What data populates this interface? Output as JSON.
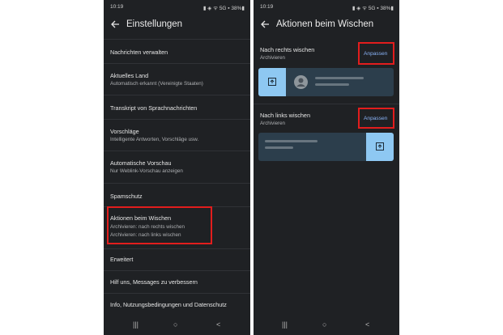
{
  "left_screen": {
    "status": {
      "time": "10:19",
      "right": "▮ ◈ ᯤ 5G ▪ 38%▮"
    },
    "title": "Einstellungen",
    "items": [
      {
        "title": "Nachrichten verwalten"
      },
      {
        "title": "Aktuelles Land",
        "subtitle": "Automatisch erkannt (Vereinigte Staaten)"
      },
      {
        "title": "Transkript von Sprachnachrichten"
      },
      {
        "title": "Vorschläge",
        "subtitle": "Intelligente Antworten, Vorschläge usw."
      },
      {
        "title": "Automatische Vorschau",
        "subtitle": "Nur Weblink-Vorschau anzeigen"
      },
      {
        "title": "Spamschutz"
      },
      {
        "title": "Aktionen beim Wischen",
        "subtitle": "Archivieren: nach rechts wischen",
        "subtitle2": "Archivieren: nach links wischen"
      },
      {
        "title": "Erweitert"
      },
      {
        "title": "Hilf uns, Messages zu verbessern"
      },
      {
        "title": "Info, Nutzungsbedingungen und Datenschutz"
      }
    ]
  },
  "right_screen": {
    "status": {
      "time": "10:19",
      "right": "▮ ◈ ᯤ 5G ▪ 38%▮"
    },
    "title": "Aktionen beim Wischen",
    "right_swipe": {
      "title": "Nach rechts wischen",
      "subtitle": "Archivieren",
      "button": "Anpassen"
    },
    "left_swipe": {
      "title": "Nach links wischen",
      "subtitle": "Archivieren",
      "button": "Anpassen"
    }
  },
  "nav": {
    "recent": "|||",
    "home": "○",
    "back": "<"
  },
  "colors": {
    "background": "#1f2124",
    "accent": "#8ab4f8",
    "highlight": "#e21d1d",
    "archive_box": "#8ec8f2"
  }
}
